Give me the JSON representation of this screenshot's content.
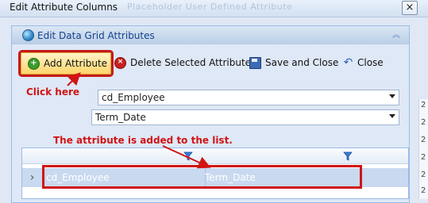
{
  "window": {
    "title": "Edit Attribute Columns",
    "background_tabs": "Placeholder   User Defined Attribute",
    "close_glyph": "×"
  },
  "dialog": {
    "title": "Edit Data Grid Attributes",
    "title_icon": "globe-icon"
  },
  "toolbar": {
    "add_label": "Add Attribute",
    "delete_label": "Delete Selected Attribute",
    "save_label": "Save and Close",
    "close_label": "Close"
  },
  "annotations": {
    "click_here": "Click here",
    "added_note": "The attribute is added to the list."
  },
  "fields": {
    "attribute_field": "cd_Employee",
    "attribute_value": "Term_Date"
  },
  "grid": {
    "rows": [
      {
        "indicator": "›",
        "field": "cd_Employee",
        "value": "Term_Date"
      }
    ]
  },
  "edge_digits": [
    "2",
    "2",
    "2",
    "2",
    "2",
    "2"
  ],
  "colors": {
    "annotation": "#d11414",
    "accent": "#15428b",
    "selected_row": "#c9d9ef"
  }
}
